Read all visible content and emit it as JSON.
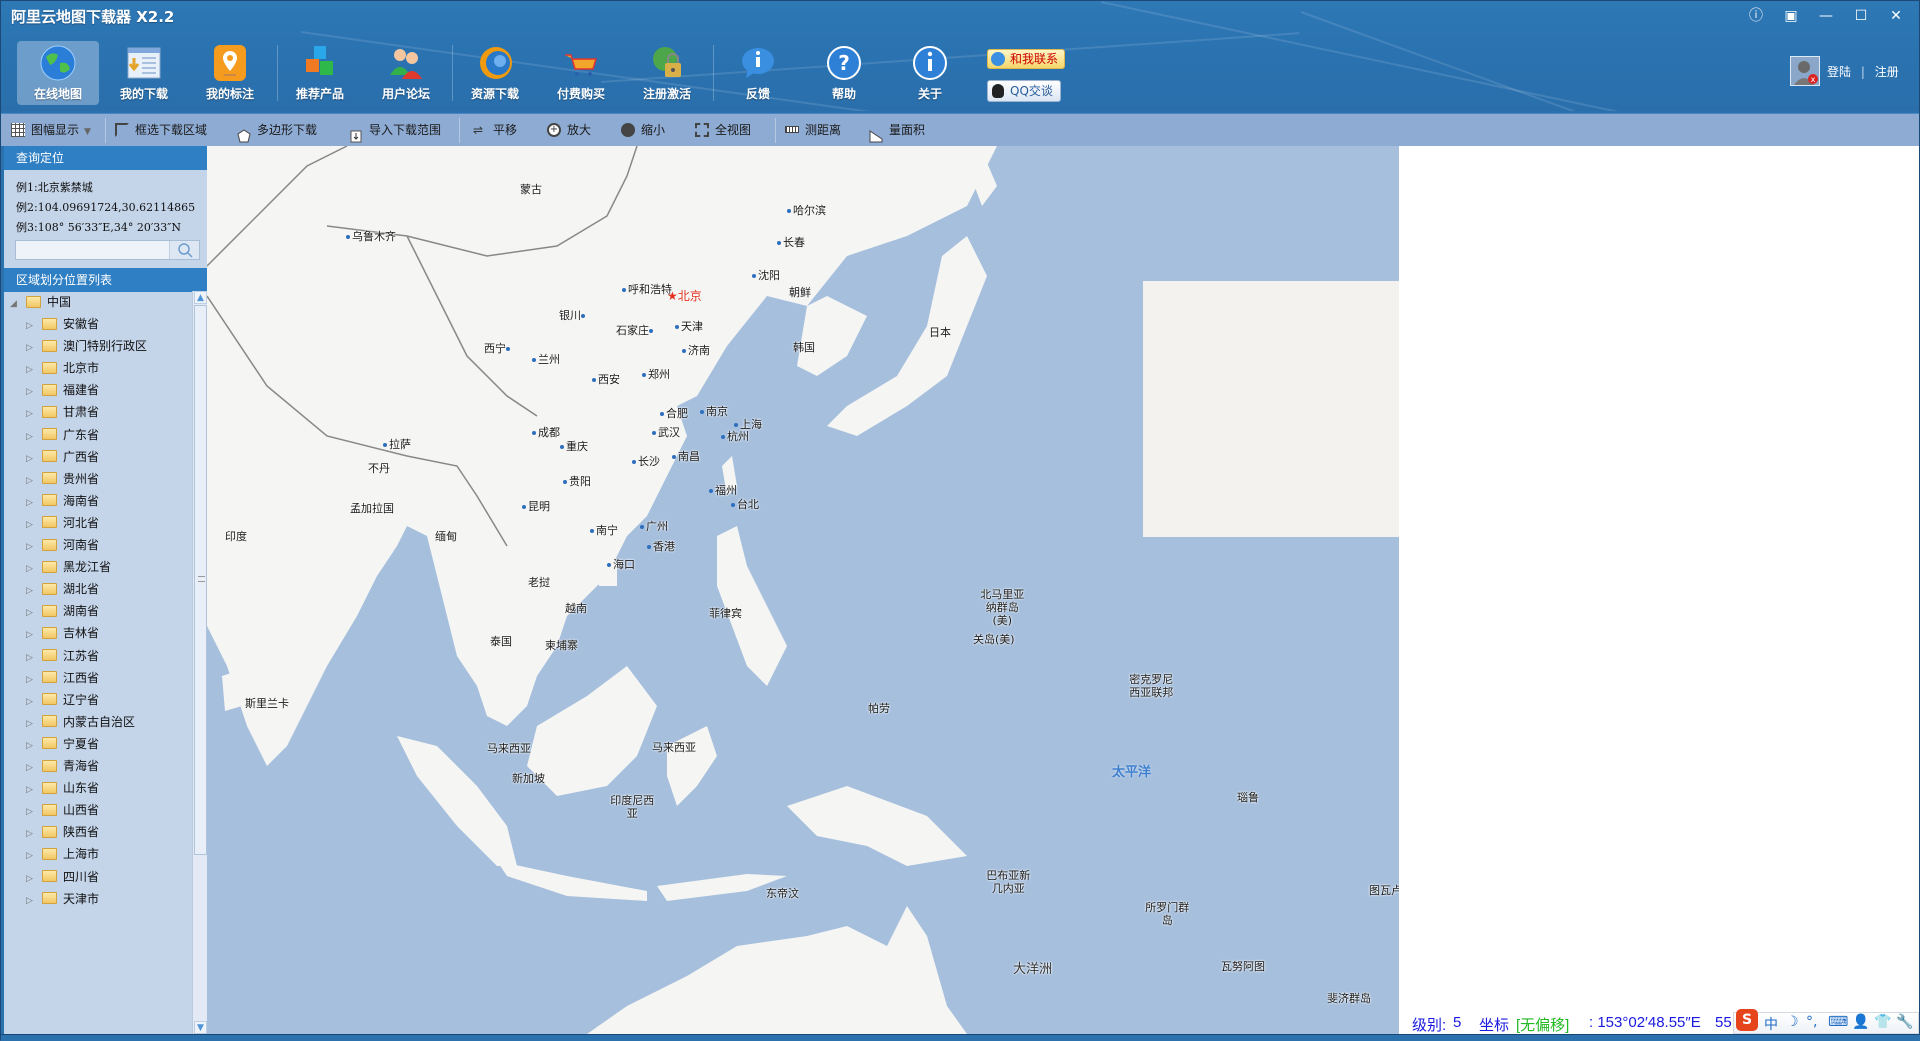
{
  "window": {
    "title": "阿里云地图下载器 X2.2",
    "controls": [
      {
        "name": "info-button",
        "glyph": "ⓘ"
      },
      {
        "name": "skin-button",
        "glyph": "▣"
      },
      {
        "name": "minimize-button",
        "glyph": "—"
      },
      {
        "name": "maximize-button",
        "glyph": "☐"
      },
      {
        "name": "close-button",
        "glyph": "✕"
      }
    ]
  },
  "nav": {
    "items": [
      {
        "label": "在线地图",
        "icon": "globe-icon",
        "active": true
      },
      {
        "label": "我的下载",
        "icon": "download-list-icon"
      },
      {
        "label": "我的标注",
        "icon": "map-pin-icon"
      },
      {
        "label": "推荐产品",
        "icon": "cubes-icon"
      },
      {
        "label": "用户论坛",
        "icon": "users-icon"
      },
      {
        "label": "资源下载",
        "icon": "resource-globe-icon"
      },
      {
        "label": "付费购买",
        "icon": "shopping-cart-icon"
      },
      {
        "label": "注册激活",
        "icon": "lock-globe-icon"
      },
      {
        "label": "反馈",
        "icon": "feedback-bubble-icon"
      },
      {
        "label": "帮助",
        "icon": "help-icon"
      },
      {
        "label": "关于",
        "icon": "about-info-icon"
      }
    ],
    "contact_label": "和我联系",
    "qq_label": "QQ交谈"
  },
  "user": {
    "login_label": "登陆",
    "separator": "|",
    "register_label": "注册"
  },
  "toolbar": {
    "items": [
      {
        "label": "图幅显示",
        "icon": "grid-icon",
        "dropdown": true
      },
      {
        "label": "框选下载区域",
        "icon": "rect-select-icon"
      },
      {
        "label": "多边形下载",
        "icon": "polygon-icon"
      },
      {
        "label": "导入下载范围",
        "icon": "import-icon"
      },
      {
        "label": "平移",
        "icon": "pan-icon"
      },
      {
        "label": "放大",
        "icon": "zoom-in-icon"
      },
      {
        "label": "缩小",
        "icon": "zoom-out-icon"
      },
      {
        "label": "全视图",
        "icon": "full-extent-icon"
      },
      {
        "label": "测距离",
        "icon": "ruler-icon"
      },
      {
        "label": "量面积",
        "icon": "area-icon"
      }
    ]
  },
  "search": {
    "header": "查询定位",
    "examples": [
      "例1:北京紫禁城",
      "例2:104.09691724,30.62114865",
      "例3:108° 56′33″E,34° 20′33″N"
    ],
    "value": "",
    "placeholder": ""
  },
  "region_list": {
    "header": "区域划分位置列表",
    "root": "中国",
    "children": [
      "安徽省",
      "澳门特别行政区",
      "北京市",
      "福建省",
      "甘肃省",
      "广东省",
      "广西省",
      "贵州省",
      "海南省",
      "河北省",
      "河南省",
      "黑龙江省",
      "湖北省",
      "湖南省",
      "吉林省",
      "江苏省",
      "江西省",
      "辽宁省",
      "内蒙古自治区",
      "宁夏省",
      "青海省",
      "山东省",
      "山西省",
      "陕西省",
      "上海市",
      "四川省",
      "天津市"
    ]
  },
  "map": {
    "capital": "北京",
    "cities": [
      "乌鲁木齐",
      "哈尔滨",
      "长春",
      "沈阳",
      "呼和浩特",
      "天津",
      "银川",
      "石家庄",
      "济南",
      "西宁",
      "兰州",
      "西安",
      "郑州",
      "合肥",
      "南京",
      "上海",
      "武汉",
      "杭州",
      "成都",
      "重庆",
      "拉萨",
      "长沙",
      "南昌",
      "贵阳",
      "福州",
      "台北",
      "昆明",
      "南宁",
      "广州",
      "香港",
      "海口"
    ],
    "countries": [
      "蒙古",
      "朝鲜",
      "韩国",
      "日本",
      "不丹",
      "孟加拉国",
      "印度",
      "缅甸",
      "老挝",
      "越南",
      "泰国",
      "柬埔寨",
      "菲律宾",
      "斯里兰卡",
      "马来西亚",
      "马来西亚",
      "新加坡",
      "印度尼西亚",
      "帕劳",
      "东帝汶",
      "北马里亚纳群岛(美)",
      "关岛(美)",
      "密克罗尼西亚联邦",
      "巴布亚新几内亚",
      "所罗门群岛",
      "瑙鲁",
      "瓦努阿图",
      "图瓦卢",
      "斐济群岛",
      "大洋洲"
    ],
    "ocean": "太平洋"
  },
  "status": {
    "level_label": "级别:",
    "level_value": "5",
    "coord_label": "坐标",
    "offset_tag": "[无偏移]",
    "coord_value": ": 153°02′48.55″E",
    "coord_lat_partial": "55"
  },
  "ime": {
    "items": [
      "S",
      "中",
      "☽",
      "°,",
      "⌨",
      "👤",
      "👕",
      "🔧"
    ]
  }
}
